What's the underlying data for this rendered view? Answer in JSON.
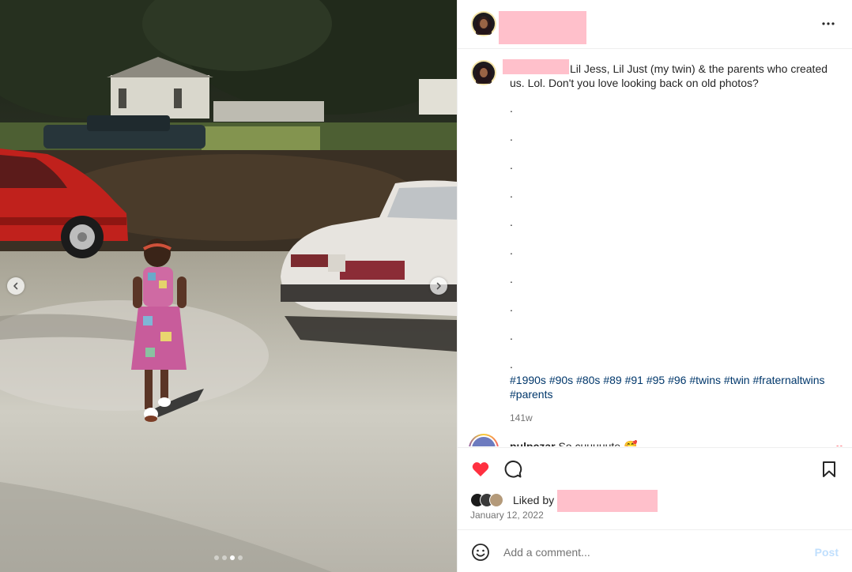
{
  "media": {
    "slide_count": 4,
    "active_slide": 3,
    "prev_icon": "chevron-left-icon",
    "next_icon": "chevron-right-icon"
  },
  "header": {
    "more_icon": "more-horizontal-icon"
  },
  "caption": {
    "text": "Lil Jess, Lil Just (my twin) & the parents who created us. Lol. Don't you love looking back on old photos?",
    "bullets": [
      ".",
      ".",
      ".",
      ".",
      ".",
      ".",
      ".",
      ".",
      ".",
      "."
    ],
    "hashtags": [
      "#1990s",
      "#90s",
      "#80s",
      "#89",
      "#91",
      "#95",
      "#96",
      "#twins",
      "#twin",
      "#fraternaltwins",
      "#parents"
    ],
    "time_ago": "141w"
  },
  "comment": {
    "username": "pulpczar",
    "text": "So cuuuuute 🥰"
  },
  "actions": {
    "like_icon": "heart-filled-icon",
    "comment_icon": "comment-icon",
    "save_icon": "bookmark-icon",
    "liked_by_label": "Liked by",
    "date": "January 12, 2022"
  },
  "add_comment": {
    "placeholder": "Add a comment...",
    "post_label": "Post",
    "emoji_icon": "emoji-icon"
  },
  "colors": {
    "like_red": "#ff3040",
    "hashtag_blue": "#00376b",
    "post_disabled": "#c0dffd",
    "redaction_pink": "#ffc0cb"
  }
}
